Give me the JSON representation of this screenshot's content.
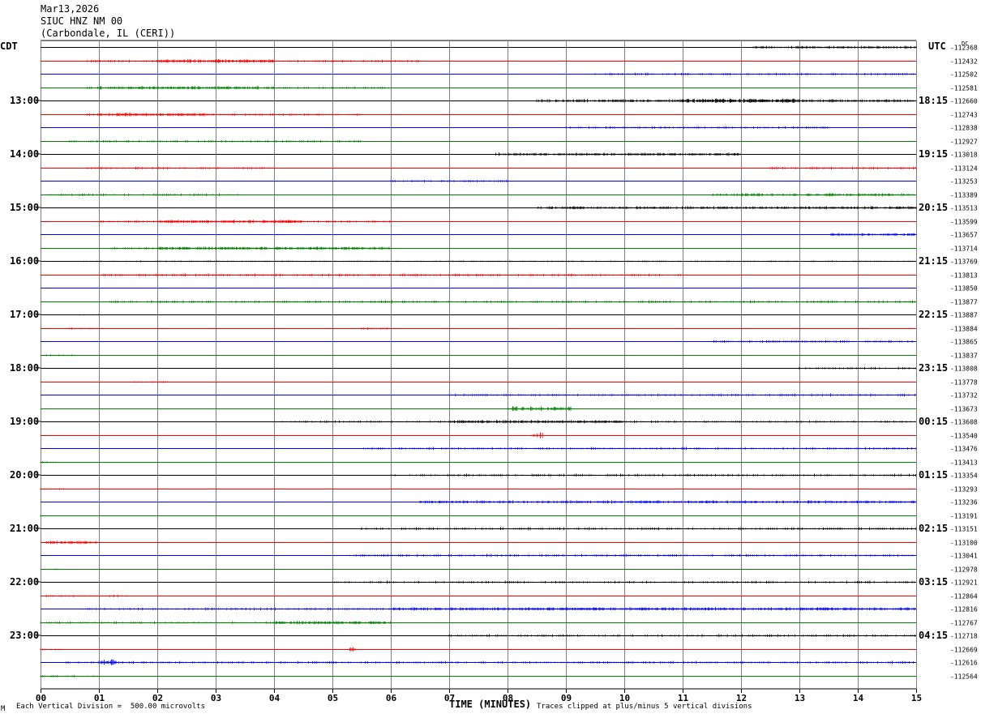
{
  "header": {
    "date": "Mar13,2026",
    "station": "SIUC HNZ NM 00",
    "location": "(Carbondale, IL (CERI))"
  },
  "left_timezone": "CDT",
  "right_timezone": "UTC",
  "dc_label": "DC",
  "footer": {
    "scale_note": "Each Vertical Division =  500.00 microvolts",
    "clip_note": "Traces clipped at plus/minus 5 vertical divisions",
    "corner_mark": "M"
  },
  "colors": {
    "black": "#000000",
    "red": "#ff0000",
    "blue": "#0000ff",
    "green": "#008000",
    "grid": "#808080"
  },
  "chart_data": {
    "type": "line",
    "title": "SIUC HNZ NM 00",
    "xlabel": "TIME (MINUTES)",
    "x_ticks": [
      "00",
      "01",
      "02",
      "03",
      "04",
      "05",
      "06",
      "07",
      "08",
      "09",
      "10",
      "11",
      "12",
      "13",
      "14",
      "15"
    ],
    "xlim": [
      0,
      15
    ],
    "color_cycle": [
      "black",
      "red",
      "blue",
      "green"
    ],
    "left_hour_labels": [
      "13:00",
      "14:00",
      "15:00",
      "16:00",
      "17:00",
      "18:00",
      "19:00",
      "20:00",
      "21:00",
      "22:00",
      "23:00"
    ],
    "right_hour_labels": [
      "18:15",
      "19:15",
      "20:15",
      "21:15",
      "22:15",
      "23:15",
      "00:15",
      "01:15",
      "02:15",
      "03:15",
      "04:15"
    ],
    "dc_offsets": [
      "-112368",
      "-112432",
      "-112502",
      "-112581",
      "-112660",
      "-112743",
      "-112838",
      "-112927",
      "-113018",
      "-113124",
      "-113253",
      "-113389",
      "-113513",
      "-113599",
      "-113657",
      "-113714",
      "-113769",
      "-113813",
      "-113850",
      "-113877",
      "-113887",
      "-113884",
      "-113865",
      "-113837",
      "-113808",
      "-113778",
      "-113732",
      "-113673",
      "-113608",
      "-113540",
      "-113476",
      "-113413",
      "-113354",
      "-113293",
      "-113236",
      "-113191",
      "-113151",
      "-113100",
      "-113041",
      "-112978",
      "-112921",
      "-112864",
      "-112816",
      "-112767",
      "-112718",
      "-112669",
      "-112616",
      "-112564"
    ],
    "traces": [
      {
        "noise": [
          [
            12.2,
            15,
            1.2
          ]
        ]
      },
      {
        "noise": [
          [
            0.8,
            6.5,
            1.0
          ],
          [
            2.0,
            4.0,
            1.6
          ]
        ]
      },
      {
        "noise": [
          [
            9.5,
            15,
            1.0
          ]
        ]
      },
      {
        "noise": [
          [
            0.8,
            6.0,
            1.0
          ],
          [
            1.0,
            4.0,
            1.4
          ]
        ]
      },
      {
        "noise": [
          [
            8.5,
            15,
            1.3
          ],
          [
            11,
            13,
            1.8
          ]
        ]
      },
      {
        "noise": [
          [
            0.8,
            5.5,
            1.0
          ],
          [
            1.0,
            3.0,
            1.4
          ]
        ]
      },
      {
        "noise": [
          [
            9.0,
            13.5,
            1.0
          ]
        ]
      },
      {
        "noise": [
          [
            0.5,
            5.5,
            1.0
          ]
        ]
      },
      {
        "noise": [
          [
            7.8,
            12.0,
            1.2
          ]
        ]
      },
      {
        "noise": [
          [
            0.8,
            4.0,
            1.0
          ],
          [
            12.5,
            15,
            1.1
          ]
        ]
      },
      {
        "noise": [
          [
            6.0,
            8.0,
            1.0
          ]
        ]
      },
      {
        "noise": [
          [
            0.1,
            3.4,
            1.0
          ],
          [
            11.5,
            15,
            1.2
          ]
        ]
      },
      {
        "noise": [
          [
            8.5,
            15,
            1.2
          ]
        ]
      },
      {
        "noise": [
          [
            1.0,
            6.0,
            1.0
          ],
          [
            2.0,
            4.5,
            1.4
          ]
        ]
      },
      {
        "noise": [
          [
            13.5,
            15,
            1.2
          ]
        ]
      },
      {
        "noise": [
          [
            1.2,
            6.0,
            1.1
          ],
          [
            2.0,
            6.0,
            1.3
          ]
        ]
      },
      {
        "noise": [
          [
            0.6,
            15,
            0.5
          ]
        ]
      },
      {
        "noise": [
          [
            1.0,
            11.0,
            1.1
          ]
        ]
      },
      {
        "noise": [
          [
            9.0,
            9.0,
            0.5
          ]
        ]
      },
      {
        "noise": [
          [
            1.0,
            15,
            1.1
          ]
        ]
      },
      {
        "noise": [
          [
            0.6,
            1.0,
            0.4
          ]
        ]
      },
      {
        "noise": [
          [
            0.5,
            1.0,
            0.6
          ],
          [
            5.5,
            6.0,
            1.0
          ]
        ]
      },
      {
        "noise": [
          [
            11.5,
            15,
            1.1
          ]
        ]
      },
      {
        "noise": [
          [
            0.1,
            0.6,
            0.6
          ]
        ]
      },
      {
        "noise": [
          [
            13.0,
            15,
            1.0
          ]
        ]
      },
      {
        "noise": [
          [
            1.6,
            2.2,
            0.6
          ]
        ]
      },
      {
        "noise": [
          [
            7.0,
            15,
            1.1
          ]
        ]
      },
      {
        "noise": [
          [
            8.0,
            9.1,
            2.0
          ]
        ]
      },
      {
        "noise": [
          [
            4.0,
            15,
            1.0
          ],
          [
            7.0,
            10.0,
            1.4
          ]
        ]
      },
      {
        "noise": [
          [
            8.4,
            8.6,
            3.0
          ]
        ]
      },
      {
        "noise": [
          [
            5.5,
            15,
            1.1
          ]
        ]
      },
      {
        "noise": [
          [
            0.0,
            0.3,
            0.6
          ]
        ]
      },
      {
        "noise": [
          [
            6.0,
            15,
            1.1
          ]
        ]
      },
      {
        "noise": [
          [
            0.0,
            0.4,
            0.6
          ]
        ]
      },
      {
        "noise": [
          [
            6.5,
            15,
            1.2
          ]
        ]
      },
      {
        "noise": [
          [
            0.0,
            0.2,
            0.4
          ]
        ]
      },
      {
        "noise": [
          [
            5.5,
            15,
            1.1
          ]
        ]
      },
      {
        "noise": [
          [
            0.1,
            0.95,
            1.4
          ]
        ]
      },
      {
        "noise": [
          [
            5.3,
            15,
            1.1
          ]
        ]
      },
      {
        "noise": [
          [
            0.1,
            0.3,
            0.6
          ]
        ]
      },
      {
        "noise": [
          [
            5.0,
            15,
            1.1
          ]
        ]
      },
      {
        "noise": [
          [
            0.1,
            1.5,
            0.8
          ]
        ]
      },
      {
        "noise": [
          [
            0.7,
            15,
            1.0
          ],
          [
            6.0,
            15,
            1.3
          ]
        ]
      },
      {
        "noise": [
          [
            0.0,
            6.0,
            0.9
          ],
          [
            4.0,
            6.0,
            1.4
          ]
        ]
      },
      {
        "noise": [
          [
            7.0,
            15,
            1.1
          ]
        ]
      },
      {
        "noise": [
          [
            0.0,
            0.4,
            0.5
          ],
          [
            5.3,
            5.4,
            2.0
          ]
        ]
      },
      {
        "noise": [
          [
            0.4,
            15,
            1.0
          ],
          [
            1.0,
            1.3,
            2.6
          ]
        ]
      },
      {
        "noise": [
          [
            0.0,
            1.0,
            0.8
          ]
        ]
      }
    ]
  }
}
